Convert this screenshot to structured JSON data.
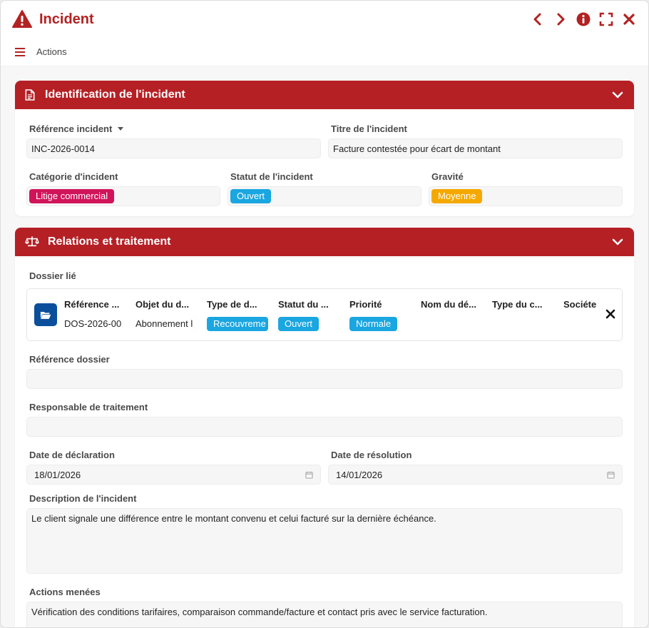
{
  "window": {
    "title": "Incident"
  },
  "menubar": {
    "actions_label": "Actions"
  },
  "colors": {
    "brand": "#b52025",
    "tag_category": "#d1145a",
    "tag_status": "#1aa6e0",
    "tag_severity": "#f5a800",
    "folder_button": "#0b4f9c"
  },
  "section_identification": {
    "title": "Identification de l'incident",
    "reference_label": "Référence incident",
    "reference_value": "INC-2026-0014",
    "title_label": "Titre de l'incident",
    "title_value": "Facture contestée pour écart de montant",
    "category_label": "Catégorie d'incident",
    "category_value": "Litige commercial",
    "status_label": "Statut de l'incident",
    "status_value": "Ouvert",
    "severity_label": "Gravité",
    "severity_value": "Moyenne"
  },
  "section_relations": {
    "title": "Relations et traitement",
    "linked_file_label": "Dossier lié",
    "linked_file": {
      "columns": [
        "Référence ...",
        "Objet du d...",
        "Type de d...",
        "Statut du ...",
        "Priorité",
        "Nom du dé...",
        "Type du c...",
        "Sociéte"
      ],
      "reference": "DOS-2026-00",
      "object": "Abonnement l",
      "type": "Recouvreme",
      "status": "Ouvert",
      "priority": "Normale"
    },
    "file_reference_label": "Référence dossier",
    "file_reference_value": "",
    "handler_label": "Responsable de traitement",
    "handler_value": "",
    "declaration_date_label": "Date de déclaration",
    "declaration_date_value": "18/01/2026",
    "resolution_date_label": "Date de résolution",
    "resolution_date_value": "14/01/2026",
    "description_label": "Description de l'incident",
    "description_value": "Le client signale une différence entre le montant convenu et celui facturé sur la dernière échéance.",
    "actions_label": "Actions menées",
    "actions_value": "Vérification des conditions tarifaires, comparaison commande/facture et contact pris avec le service facturation."
  }
}
